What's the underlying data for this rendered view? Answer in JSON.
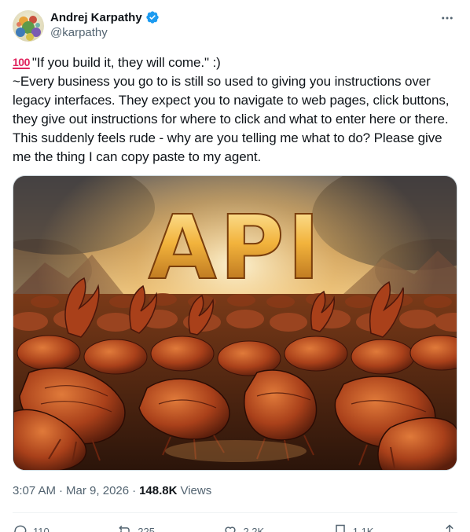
{
  "author": {
    "display_name": "Andrej Karpathy",
    "handle": "@karpathy",
    "verified_color": "#1d9bf0"
  },
  "tweet": {
    "emoji_label": "100",
    "text": "\"If you build it, they will come.\" :)\n~Every business you go to is still so used to giving you instructions over legacy interfaces. They expect you to navigate to web pages, click buttons, they give out instructions for where to click and what to enter here or there. This suddenly feels rude - why are you telling me what to do? Please give me the thing I can copy paste to my agent.",
    "media_word": "API"
  },
  "meta": {
    "time": "3:07 AM",
    "separator": "·",
    "date": "Mar 9, 2026",
    "views_count": "148.8K",
    "views_label": "Views"
  },
  "actions": {
    "replies": "110",
    "reposts": "225",
    "likes": "2.2K",
    "bookmarks": "1.1K"
  },
  "colors": {
    "text_primary": "#0f1419",
    "text_secondary": "#536471",
    "accent": "#1d9bf0"
  },
  "icons": {
    "more": "more-dots-icon",
    "verified": "verified-badge-icon",
    "reply": "reply-icon",
    "repost": "repost-icon",
    "like": "heart-icon",
    "bookmark": "bookmark-icon",
    "share": "share-icon"
  }
}
